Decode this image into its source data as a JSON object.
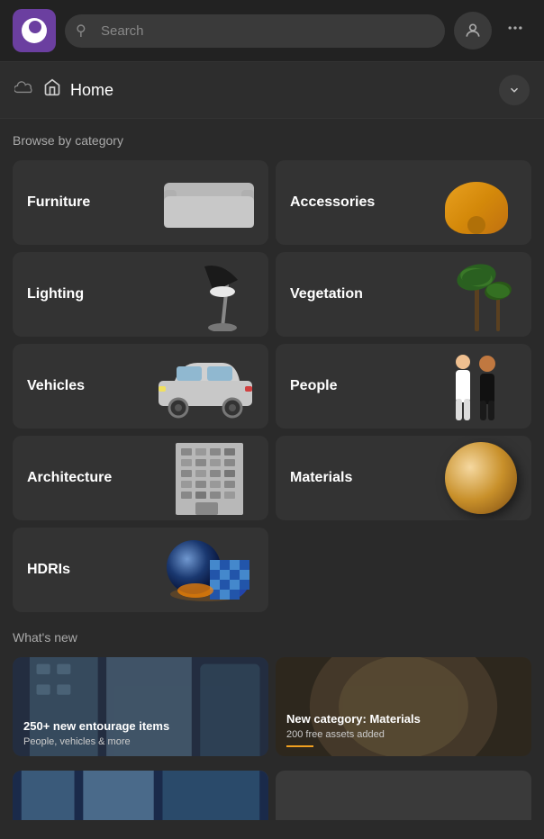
{
  "header": {
    "search_placeholder": "Search",
    "logo_alt": "Chaos Cosmos logo"
  },
  "breadcrumb": {
    "title": "Home"
  },
  "browse": {
    "section_title": "Browse by category",
    "categories": [
      {
        "id": "furniture",
        "label": "Furniture"
      },
      {
        "id": "accessories",
        "label": "Accessories"
      },
      {
        "id": "lighting",
        "label": "Lighting"
      },
      {
        "id": "vegetation",
        "label": "Vegetation"
      },
      {
        "id": "vehicles",
        "label": "Vehicles"
      },
      {
        "id": "people",
        "label": "People"
      },
      {
        "id": "architecture",
        "label": "Architecture"
      },
      {
        "id": "materials",
        "label": "Materials"
      },
      {
        "id": "hdris",
        "label": "HDRIs"
      }
    ]
  },
  "whats_new": {
    "section_title": "What's new",
    "items": [
      {
        "id": "entourage",
        "title": "250+ new entourage items",
        "subtitle": "People, vehicles & more"
      },
      {
        "id": "materials_new",
        "title": "New category: Materials",
        "subtitle": "200 free assets added"
      }
    ]
  }
}
